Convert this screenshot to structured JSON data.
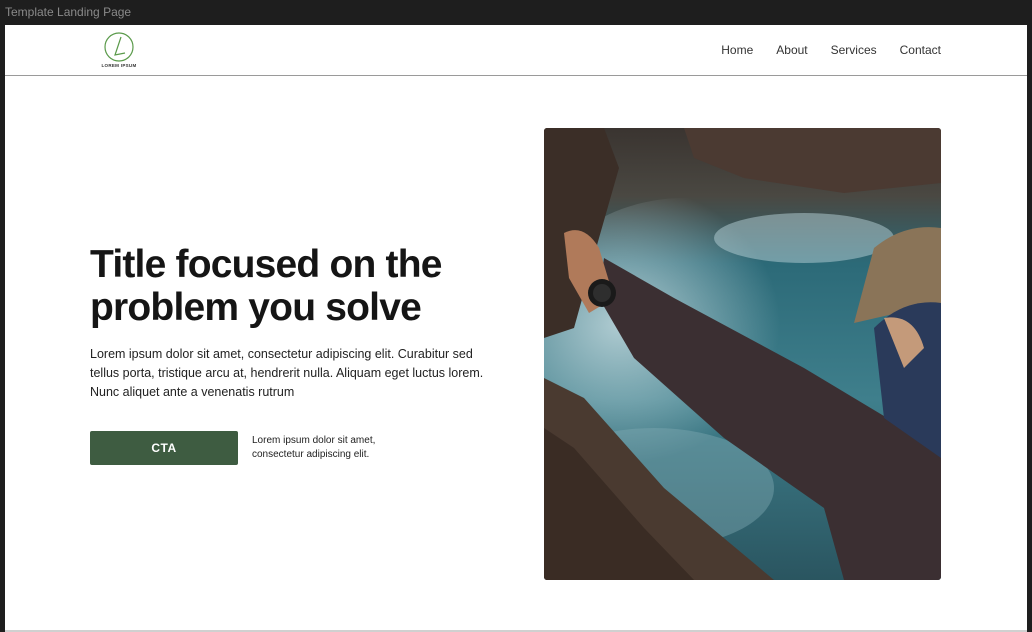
{
  "window": {
    "title": "Template Landing Page"
  },
  "logo": {
    "text": "LOREM IPSUM",
    "icon": "circle-leaf-logo-icon",
    "color": "#5a9a4a"
  },
  "nav": {
    "items": [
      {
        "label": "Home"
      },
      {
        "label": "About"
      },
      {
        "label": "Services"
      },
      {
        "label": "Contact"
      }
    ]
  },
  "hero": {
    "title_line1": "Title focused on the",
    "title_line2": "problem you solve",
    "body": "Lorem ipsum dolor sit amet, consectetur adipiscing elit. Curabitur sed tellus porta, tristique arcu at, hendrerit nulla. Aliquam eget luctus lorem. Nunc aliquet ante a venenatis rutrum",
    "cta_label": "CTA",
    "cta_note": "Lorem ipsum dolor sit amet, consectetur adipiscing elit.",
    "cta_color": "#3e5c41",
    "image": "photo of hiker with watch holding branch above ocean waves"
  }
}
